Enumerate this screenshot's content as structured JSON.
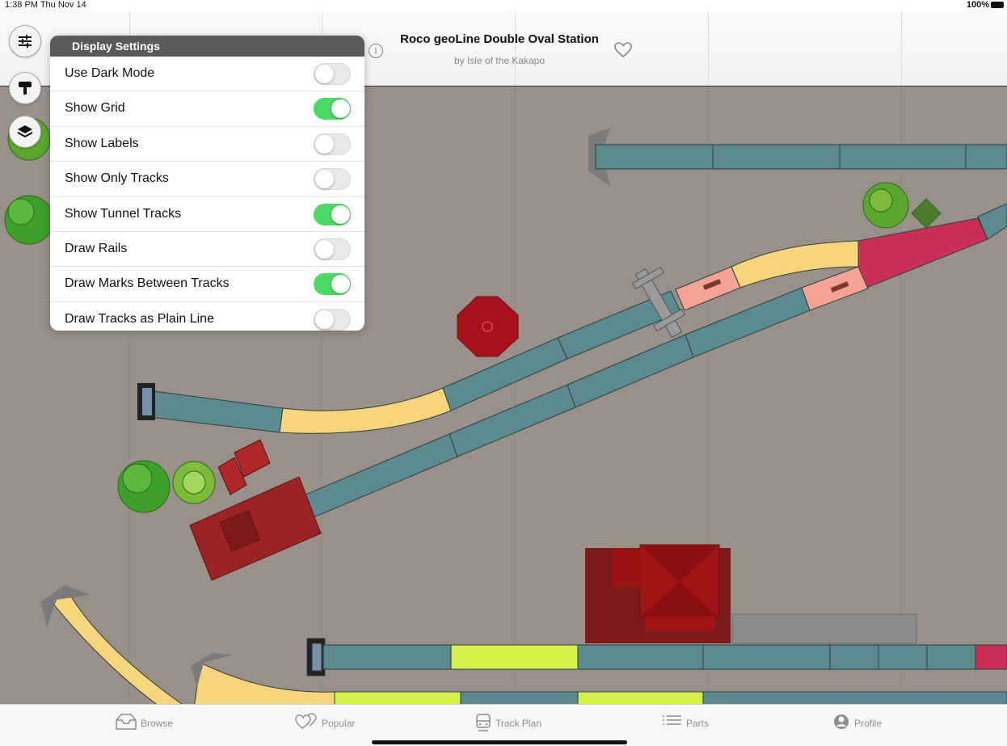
{
  "status_bar": {
    "time": "1:38 PM  Thu Nov 14",
    "battery": "100%"
  },
  "header": {
    "title": "Roco geoLine Double Oval Station",
    "subtitle": "by Isle of the Kakapo"
  },
  "toolbar_icons": [
    "sliders-icon",
    "paint-roller-icon",
    "layers-icon"
  ],
  "display_settings": {
    "title": "Display Settings",
    "items": [
      {
        "label": "Use Dark Mode",
        "on": false
      },
      {
        "label": "Show Grid",
        "on": true
      },
      {
        "label": "Show Labels",
        "on": false
      },
      {
        "label": "Show Only Tracks",
        "on": false
      },
      {
        "label": "Show Tunnel Tracks",
        "on": true
      },
      {
        "label": "Draw Rails",
        "on": false
      },
      {
        "label": "Draw Marks Between Tracks",
        "on": true
      },
      {
        "label": "Draw Tracks as Plain Line",
        "on": false
      }
    ]
  },
  "tabs": [
    {
      "label": "Browse",
      "icon": "tray-icon",
      "active": false
    },
    {
      "label": "Popular",
      "icon": "hearts-icon",
      "active": false
    },
    {
      "label": "Track Plan",
      "icon": "train-icon",
      "active": true
    },
    {
      "label": "Parts",
      "icon": "list-icon",
      "active": false
    },
    {
      "label": "Profile",
      "icon": "person-icon",
      "active": false
    }
  ],
  "colors": {
    "ground": "#999189",
    "track_straight": "#5b8b8f",
    "track_curve": "#f7d57a",
    "track_switch_left": "#d6f04a",
    "track_switch_red": "#cc2f55",
    "track_salmon": "#f5a393",
    "building": "#8c2222",
    "tree": "#3f9f2a",
    "toggle_on": "#4cd964"
  }
}
